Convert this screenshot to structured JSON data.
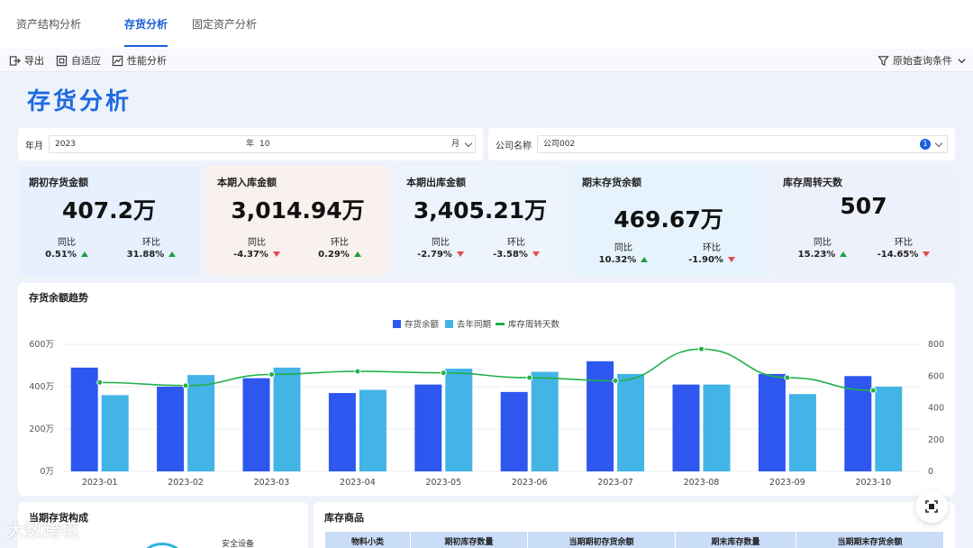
{
  "tabs": [
    {
      "label": "资产结构分析",
      "active": false
    },
    {
      "label": "存货分析",
      "active": true
    },
    {
      "label": "固定资产分析",
      "active": false
    }
  ],
  "toolbar": {
    "export_label": "导出",
    "fit_label": "自适应",
    "perf_label": "性能分析",
    "query_label": "原始查询条件"
  },
  "page_title": "存货分析",
  "filters": {
    "year_label": "年月",
    "year_value": "2023",
    "year_unit": "年",
    "month_value": "10",
    "month_unit": "月",
    "company_label": "公司名称",
    "company_value": "公司002",
    "company_count": "1"
  },
  "kpis": [
    {
      "title": "期初存货金额",
      "value": "407.2万",
      "yoy_label": "同比",
      "yoy": "0.51%",
      "yoy_dir": "up",
      "mom_label": "环比",
      "mom": "31.88%",
      "mom_dir": "up",
      "bg": "#e6f0ff"
    },
    {
      "title": "本期入库金额",
      "value": "3,014.94万",
      "yoy_label": "同比",
      "yoy": "-4.37%",
      "yoy_dir": "down",
      "mom_label": "环比",
      "mom": "0.29%",
      "mom_dir": "up",
      "bg": "#f8f1ee"
    },
    {
      "title": "本期出库金额",
      "value": "3,405.21万",
      "yoy_label": "同比",
      "yoy": "-2.79%",
      "yoy_dir": "down",
      "mom_label": "环比",
      "mom": "-3.58%",
      "mom_dir": "down",
      "bg": "#eef4fd"
    },
    {
      "title": "期末存货余额",
      "value": "469.67万",
      "yoy_label": "同比",
      "yoy": "10.32%",
      "yoy_dir": "up",
      "mom_label": "环比",
      "mom": "-1.90%",
      "mom_dir": "down",
      "bg": "#e6f3fc"
    },
    {
      "title": "库存周转天数",
      "value": "507",
      "yoy_label": "同比",
      "yoy": "15.23%",
      "yoy_dir": "up",
      "mom_label": "环比",
      "mom": "-14.65%",
      "mom_dir": "down",
      "bg": "#eef0fb"
    }
  ],
  "chart_section_title": "存货余额趋势",
  "chart_data": {
    "type": "bar",
    "categories": [
      "2023-01",
      "2023-02",
      "2023-03",
      "2023-04",
      "2023-05",
      "2023-06",
      "2023-07",
      "2023-08",
      "2023-09",
      "2023-10"
    ],
    "series": [
      {
        "name": "存货余额",
        "values": [
          490,
          400,
          440,
          370,
          410,
          375,
          520,
          410,
          460,
          450
        ],
        "color": "#2e57f0"
      },
      {
        "name": "去年同期",
        "values": [
          360,
          455,
          490,
          385,
          485,
          470,
          460,
          410,
          365,
          400
        ],
        "color": "#43b4e6"
      },
      {
        "name": "库存周转天数",
        "type": "line",
        "axis": "right",
        "values": [
          560,
          540,
          610,
          630,
          620,
          590,
          570,
          770,
          590,
          510
        ],
        "color": "#21b04b"
      }
    ],
    "y_left": {
      "ticks": [
        "0万",
        "200万",
        "400万",
        "600万"
      ],
      "tick_values": [
        0,
        200,
        400,
        600
      ],
      "range": [
        0,
        600
      ]
    },
    "y_right": {
      "ticks": [
        "0",
        "200",
        "400",
        "600",
        "800"
      ],
      "tick_values": [
        0,
        200,
        400,
        600,
        800
      ],
      "range": [
        0,
        800
      ]
    },
    "legend_position": "top-center",
    "grid": true
  },
  "bottom": {
    "composition_title": "当期存货构成",
    "composition_label": "安全设备",
    "stock_title": "库存商品",
    "table_headers": [
      "物料小类",
      "期初库存数量",
      "当期期初存货余额",
      "期末库存数量",
      "当期期末存货余额"
    ]
  },
  "watermark": "大数跨境"
}
